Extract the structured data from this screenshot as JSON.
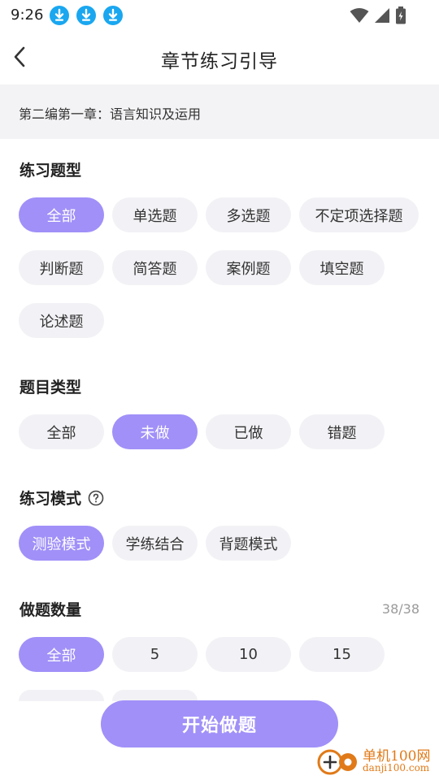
{
  "status_bar": {
    "time": "9:26",
    "notification_icons": [
      "download-icon",
      "download-icon",
      "download-icon"
    ],
    "system_icons": [
      "wifi-icon",
      "signal-icon",
      "battery-icon"
    ],
    "accent_color": "#1aa7f0"
  },
  "nav": {
    "back_icon": "chevron-left-icon",
    "title": "章节练习引导"
  },
  "chapter": {
    "text": "第二编第一章：语言知识及运用"
  },
  "sections": {
    "question_type": {
      "title": "练习题型",
      "options": [
        "全部",
        "单选题",
        "多选题",
        "不定项选择题",
        "判断题",
        "简答题",
        "案例题",
        "填空题",
        "论述题"
      ],
      "selected": "全部"
    },
    "item_type": {
      "title": "题目类型",
      "options": [
        "全部",
        "未做",
        "已做",
        "错题"
      ],
      "selected": "未做"
    },
    "mode": {
      "title": "练习模式",
      "help_icon": "question-circle-icon",
      "options": [
        "测验模式",
        "学练结合",
        "背题模式"
      ],
      "selected": "测验模式"
    },
    "count": {
      "title": "做题数量",
      "count_label": "38/38",
      "options": [
        "全部",
        "5",
        "10",
        "15"
      ],
      "selected": "全部"
    }
  },
  "start_button": {
    "label": "开始做题"
  },
  "watermark": {
    "line1": "单机100网",
    "line2": "danji100.com"
  },
  "colors": {
    "primary": "#a090f8",
    "chip_bg": "#f2f2f6",
    "strip_bg": "#f3f3f5"
  }
}
